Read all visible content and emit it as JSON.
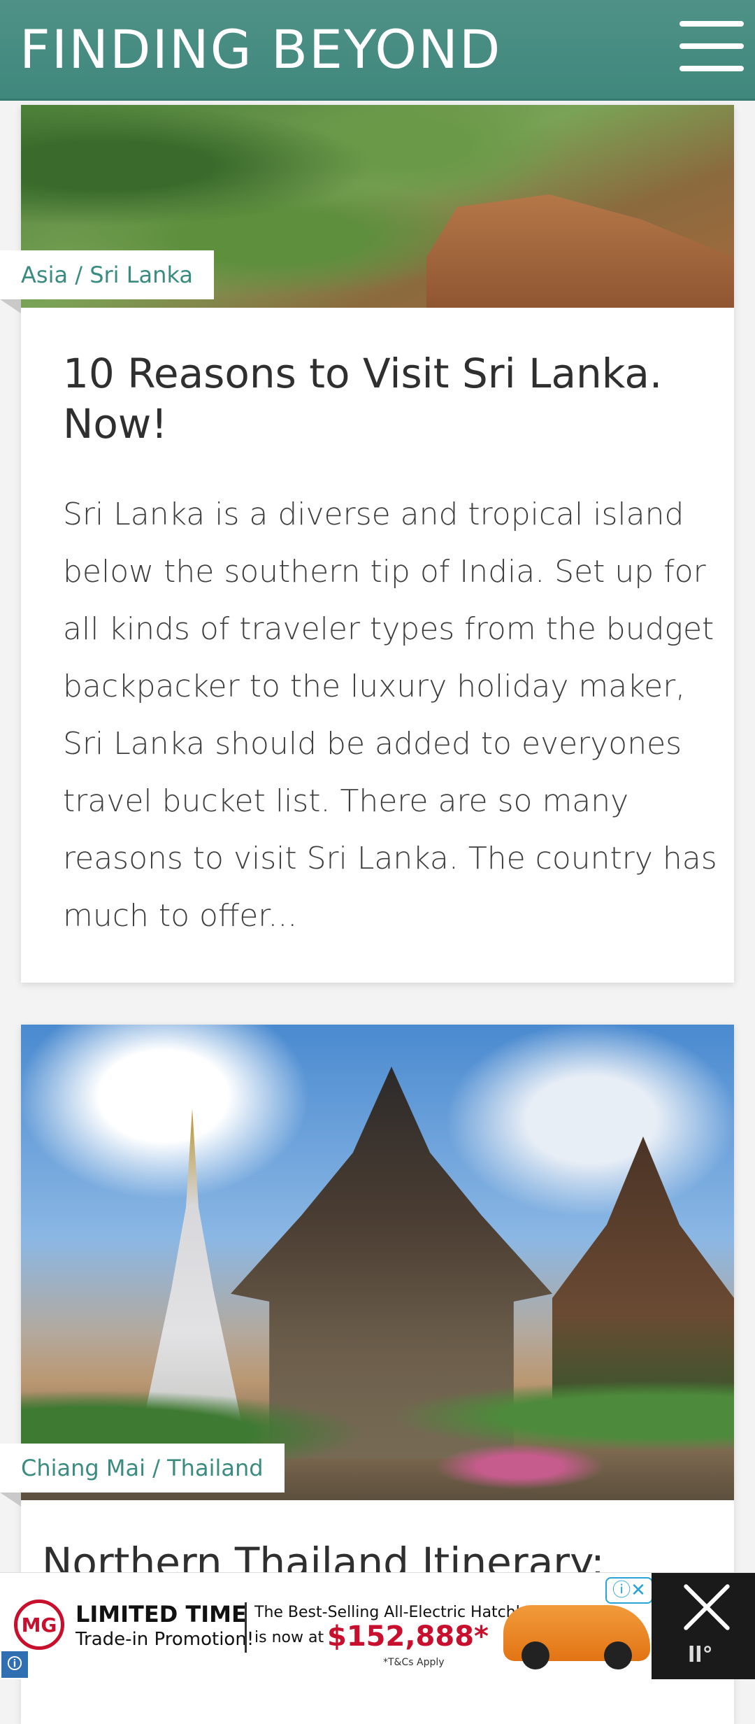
{
  "header": {
    "brand": "FINDING BEYOND",
    "menu_icon": "hamburger-menu-icon"
  },
  "posts": [
    {
      "category": "Asia / Sri Lanka",
      "title": "10 Reasons to Visit Sri Lanka. Now!",
      "excerpt": "Sri Lanka is a diverse and tropical island below the southern tip of India. Set up for all kinds of traveler types from the budget backpacker to the luxury holiday maker, Sri Lanka should be added to everyones travel bucket list. There are so many reasons to visit Sri Lanka. The country has much to offer..."
    },
    {
      "category": "Chiang Mai / Thailand",
      "title": "Northern Thailand Itinerary:"
    }
  ],
  "ad": {
    "logo": "MG",
    "headline": "LIMITED TIME",
    "subline": "Trade-in Promotion!",
    "desc_line1": "The Best-Selling All-Electric Hatchback",
    "desc_line2": "is now at",
    "price": "$152,888*",
    "terms": "*T&Cs Apply",
    "choices_glyph": "ⓘ✕",
    "brand_mark": "ll°",
    "info_glyph": "🛈"
  }
}
